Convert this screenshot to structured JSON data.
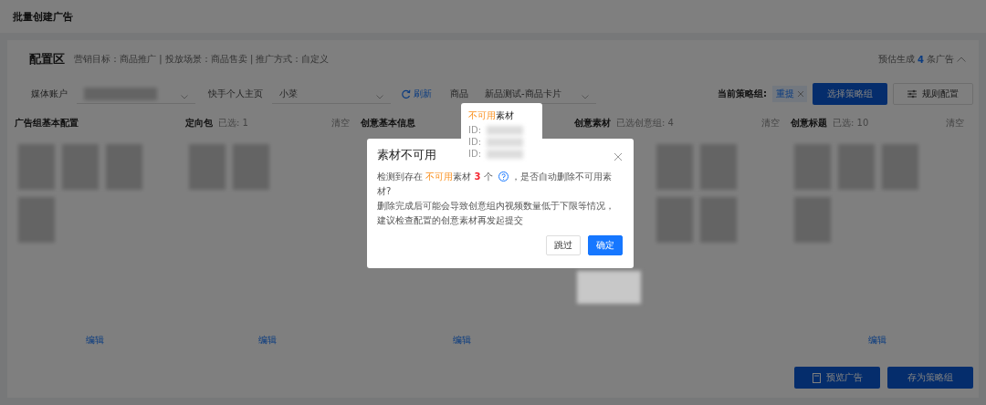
{
  "page_title": "批量创建广告",
  "config": {
    "title": "配置区",
    "summary": "营销目标：商品推广 | 投放场景：商品售卖 | 推广方式：自定义",
    "estimate": {
      "prefix": "预估生成",
      "count": "4",
      "suffix": "条广告"
    }
  },
  "filters": [
    {
      "kind": "blurred",
      "label": "媒体账户"
    },
    {
      "kind": "select",
      "label": "快手个人主页",
      "value": "小菜"
    },
    {
      "kind": "refresh",
      "label": "刷新"
    },
    {
      "kind": "select",
      "label": "商品",
      "value": "新品测试-商品卡片"
    }
  ],
  "strategy": {
    "label": "当前策略组:",
    "tag": "重提",
    "select_button": "选择策略组",
    "rules_button": "规则配置"
  },
  "columns": [
    {
      "title": "广告组基本配置",
      "edit": "编辑"
    },
    {
      "title": "定向包",
      "note": "已选: 1",
      "clear": "清空",
      "edit": "编辑"
    },
    {
      "title": "创意基本信息",
      "edit": "编辑"
    },
    {
      "title": "创意素材",
      "note": "已选创意组: 4",
      "clear": "清空"
    },
    {
      "title": "创意标题",
      "note": "已选: 10",
      "clear": "清空",
      "edit": "编辑"
    }
  ],
  "footer_buttons": [
    {
      "label": "预览广告",
      "kind": "preview"
    },
    {
      "label": "存为策略组",
      "kind": "plain"
    }
  ],
  "dialog": {
    "title": "素材不可用",
    "segments": [
      {
        "kind": "text",
        "text": "检测到存在 "
      },
      {
        "kind": "warn",
        "text": "不可用"
      },
      {
        "kind": "text",
        "text": "素材 "
      },
      {
        "kind": "count",
        "text": "3"
      },
      {
        "kind": "text",
        "text": " 个 "
      },
      {
        "kind": "help"
      },
      {
        "kind": "text",
        "text": "，是否自动删除不可用素材?"
      }
    ],
    "note": "删除完成后可能会导致创意组内视频数量低于下限等情况，建议检查配置的创意素材再发起提交",
    "buttons": [
      {
        "label": "跳过",
        "primary": false
      },
      {
        "label": "确定",
        "primary": true
      }
    ]
  },
  "tooltip": {
    "warn": "不可用",
    "rest": "素材",
    "ids": [
      "ID:",
      "ID:",
      "ID:"
    ]
  }
}
